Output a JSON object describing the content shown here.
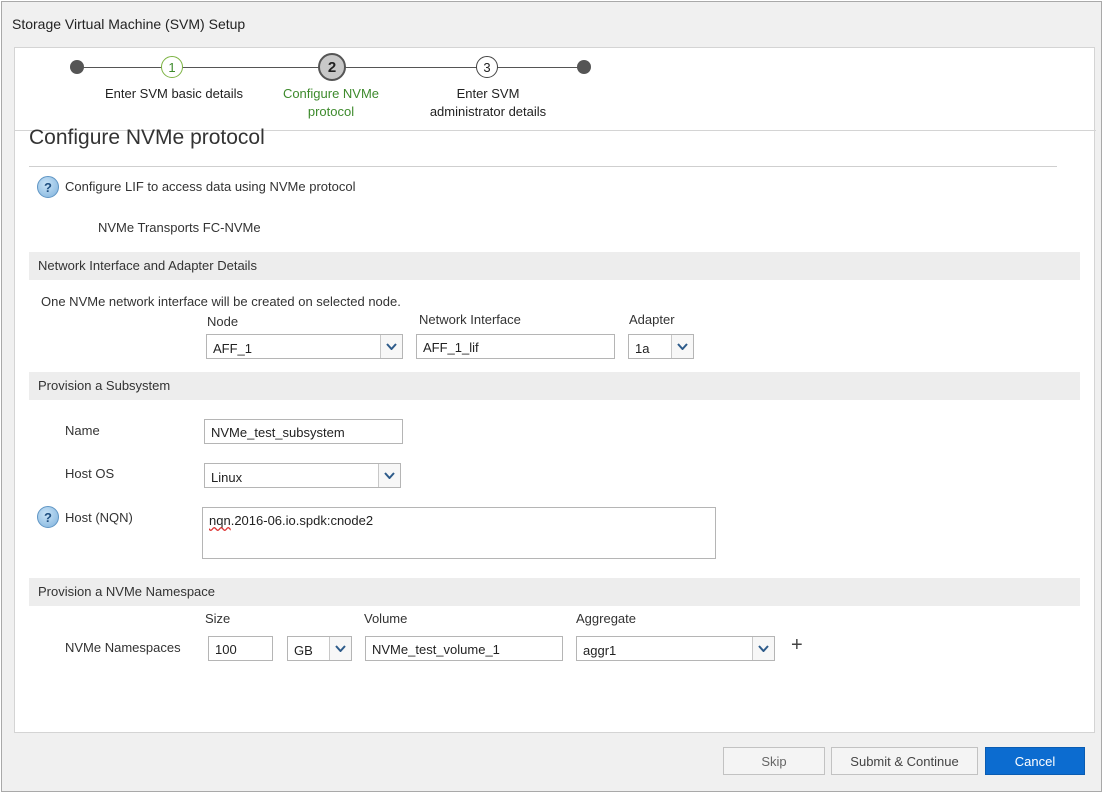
{
  "window": {
    "title": "Storage Virtual Machine (SVM) Setup"
  },
  "wizard": {
    "steps": [
      {
        "number": "1",
        "label_line1": "Enter SVM basic details",
        "label_line2": ""
      },
      {
        "number": "2",
        "label_line1": "Configure NVMe",
        "label_line2": "protocol"
      },
      {
        "number": "3",
        "label_line1": "Enter SVM",
        "label_line2": "administrator details"
      }
    ],
    "colors": {
      "completed": "#3d8a2c",
      "current": "#c8c8c8"
    }
  },
  "page": {
    "heading": "Configure NVMe protocol",
    "help_text": "Configure LIF to access data using NVMe protocol",
    "transports_label": "NVMe Transports",
    "transports_value": "FC-NVMe"
  },
  "network_section": {
    "title": "Network Interface and Adapter Details",
    "info": "One NVMe network interface will be created on selected node.",
    "node_label": "Node",
    "node_value": "AFF_1",
    "interface_label": "Network Interface",
    "interface_value": "AFF_1_lif",
    "adapter_label": "Adapter",
    "adapter_value": "1a"
  },
  "subsystem_section": {
    "title": "Provision a Subsystem",
    "name_label": "Name",
    "name_value": "NVMe_test_subsystem",
    "host_os_label": "Host OS",
    "host_os_value": "Linux",
    "host_nqn_label": "Host (NQN)",
    "host_nqn_value_misspelled": "nqn",
    "host_nqn_value_rest": ".2016-06.io.spdk:cnode2"
  },
  "namespace_section": {
    "title": "Provision a NVMe Namespace",
    "size_label": "Size",
    "volume_label": "Volume",
    "aggregate_label": "Aggregate",
    "row_label": "NVMe Namespaces",
    "size_value": "100",
    "unit_value": "GB",
    "volume_value": "NVMe_test_volume_1",
    "aggregate_value": "aggr1",
    "add_symbol": "+"
  },
  "footer": {
    "skip_label": "Skip",
    "submit_label": "Submit & Continue",
    "cancel_label": "Cancel"
  },
  "icons": {
    "help": "question-mark-icon",
    "dropdown": "chevron-down-icon",
    "add": "plus-icon"
  }
}
